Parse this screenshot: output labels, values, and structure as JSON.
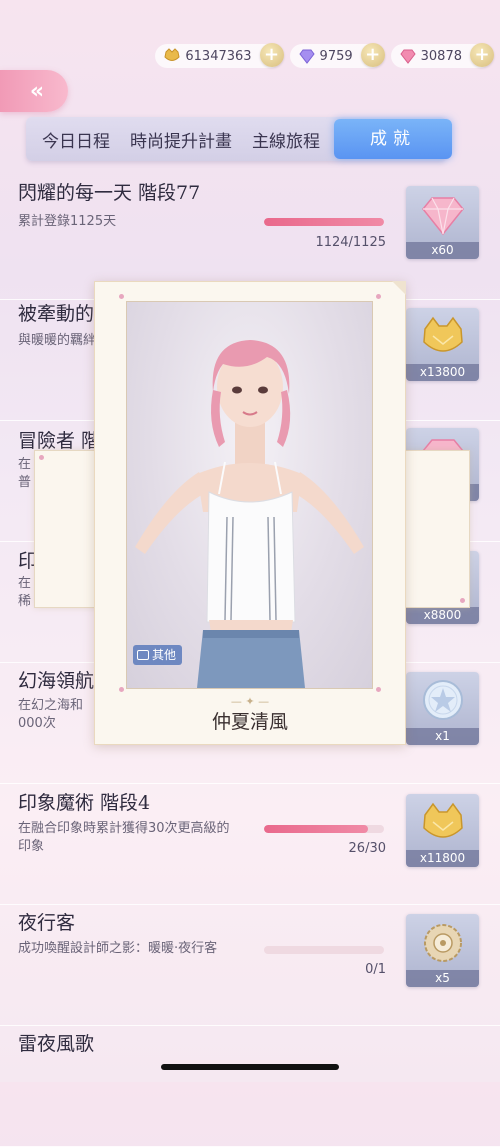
{
  "currency": {
    "gold": "61347363",
    "diamond_blue": "9759",
    "diamond_pink": "30878",
    "plus": "+"
  },
  "back": {
    "glyph": "«"
  },
  "tabs": [
    {
      "label": "今日日程"
    },
    {
      "label": "時尚提升計畫"
    },
    {
      "label": "主線旅程"
    },
    {
      "label": "成就"
    }
  ],
  "achievements": [
    {
      "title": "閃耀的每一天 階段77",
      "desc": "累計登錄1125天",
      "progress_text": "1124/1125",
      "progress": 0.999,
      "reward_icon": "pink-diamond-icon",
      "reward_qty": "x60"
    },
    {
      "title": "被牽動的心",
      "desc": "與暖暖的羈絆",
      "reward_icon": "gold-cat-coin-icon",
      "reward_qty": "x13800"
    },
    {
      "title": "冒險者 階",
      "desc": "在\n普",
      "reward_icon": "pink-diamond-icon",
      "reward_qty": ""
    },
    {
      "title": "印",
      "desc": "在\n稀",
      "reward_icon": "gold-cat-coin-icon",
      "reward_qty": "x8800"
    },
    {
      "title": "幻海領航",
      "desc": "在幻之海和\n000次",
      "reward_icon": "silver-medal-icon",
      "reward_qty": "x1"
    },
    {
      "title": "印象魔術 階段4",
      "desc": "在融合印象時累計獲得30次更高級的\n印象",
      "progress_text": "26/30",
      "progress": 0.867,
      "reward_icon": "gold-cat-coin-icon",
      "reward_qty": "x11800"
    },
    {
      "title": "夜行客",
      "desc": "成功喚醒設計師之影：暖暖·夜行客",
      "progress_text": "0/1",
      "progress": 0,
      "reward_icon": "gear-brooch-icon",
      "reward_qty": "x5"
    },
    {
      "title": "雷夜風歌",
      "desc": ""
    }
  ],
  "card": {
    "tag": "其他",
    "title": "仲夏清風",
    "ornament": "— ✦ —"
  },
  "colors": {
    "accent_pink": "#e9698c",
    "tab_active": "#5a94f2"
  }
}
